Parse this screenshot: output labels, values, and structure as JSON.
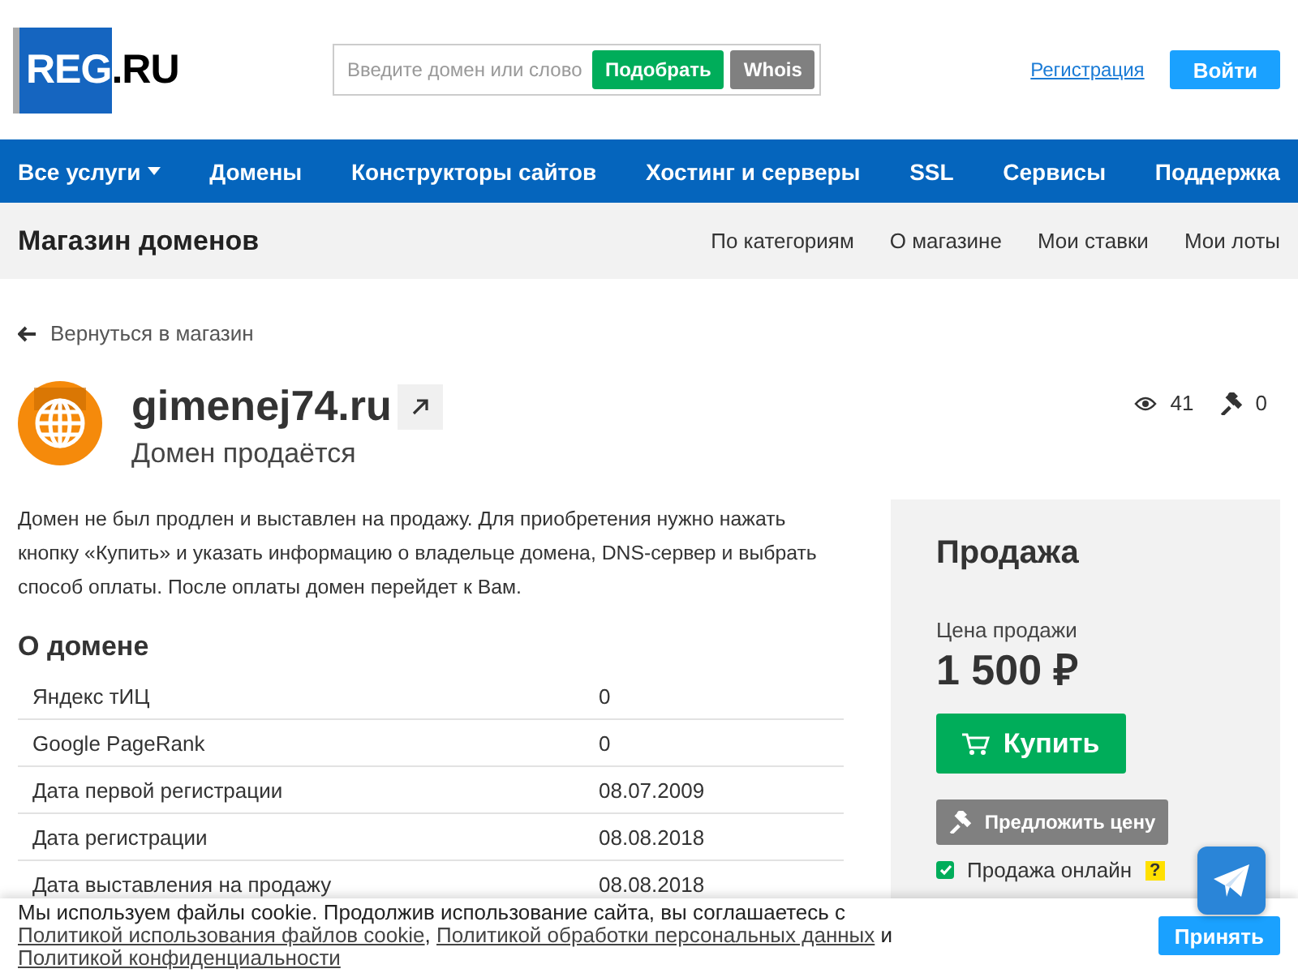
{
  "header": {
    "logo": "REG.RU",
    "search": {
      "placeholder": "Введите домен или слово",
      "buttons": [
        "Подобрать",
        "Whois"
      ]
    },
    "register_link": "Регистрация",
    "login_button": "Войти"
  },
  "nav": [
    {
      "label": "Все услуги",
      "dropdown": true
    },
    {
      "label": "Домены",
      "dropdown": false
    },
    {
      "label": "Конструкторы сайтов",
      "dropdown": false
    },
    {
      "label": "Хостинг и серверы",
      "dropdown": false
    },
    {
      "label": "SSL",
      "dropdown": false
    },
    {
      "label": "Сервисы",
      "dropdown": false
    },
    {
      "label": "Поддержка",
      "dropdown": false
    }
  ],
  "subheader": {
    "title": "Магазин доменов",
    "links": [
      "По категориям",
      "О магазине",
      "Мои ставки",
      "Мои лоты"
    ]
  },
  "back_link": "Вернуться в магазин",
  "domain": {
    "name": "gimenej74.ru",
    "status": "Домен продаётся",
    "views": "41",
    "bids": "0"
  },
  "description": "Домен не был продлен и выставлен на продажу. Для приобретения нужно нажать кнопку «Купить» и указать информацию о владельце домена, DNS-сервер и выбрать способ оплаты. После оплаты домен перейдет к Вам.",
  "about": {
    "title": "О домене",
    "rows": [
      {
        "label": "Яндекс тИЦ",
        "value": "0"
      },
      {
        "label": "Google PageRank",
        "value": "0"
      },
      {
        "label": "Дата первой регистрации",
        "value": "08.07.2009"
      },
      {
        "label": "Дата регистрации",
        "value": "08.08.2018"
      },
      {
        "label": "Дата выставления на продажу",
        "value": "08.08.2018"
      }
    ]
  },
  "sale": {
    "title": "Продажа",
    "price_label": "Цена продажи",
    "price": "1 500 ₽",
    "buy_button": "Купить",
    "offer_button": "Предложить цену",
    "online": {
      "label": "Продажа онлайн",
      "checked": true,
      "help": "?"
    }
  },
  "cookie": {
    "text_before": "Мы используем файлы cookie. Продолжив использование сайта, вы соглашаетесь с ",
    "link1": "Политикой использования файлов cookie",
    "sep1": ",",
    "link2": "Политикой обработки персональных данных",
    "sep2": " и ",
    "link3": "Политикой конфиденциальности",
    "accept": "Принять"
  }
}
